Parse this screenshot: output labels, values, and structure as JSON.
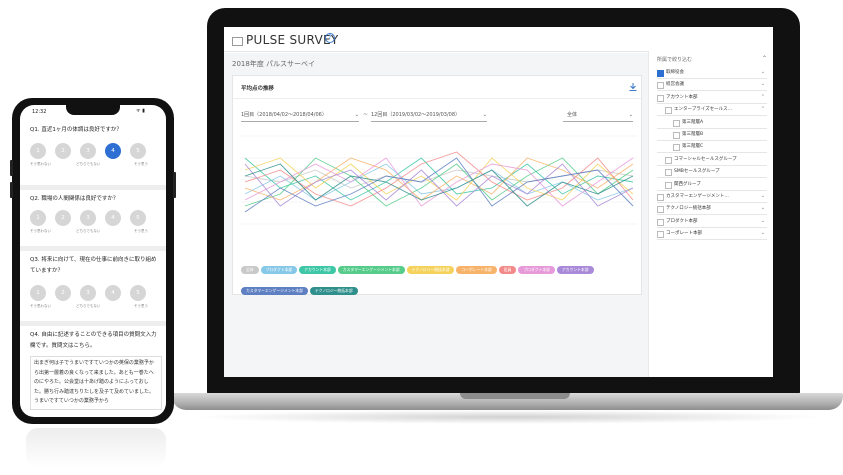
{
  "laptop": {
    "app_title": "PULSE SURVEY",
    "help_icon": "?",
    "survey_subtitle": "2018年度 パルスサーベイ",
    "card": {
      "title": "平均点の推移",
      "period_from": "1回目（2018/04/02～2018/04/06）",
      "period_to": "12回目（2019/03/02～2019/03/08）",
      "period_separator": "~",
      "scope": "全体"
    },
    "legend": [
      {
        "label": "全体",
        "color": "#c9c9c9"
      },
      {
        "label": "プロダクト本部",
        "color": "#86c8e8"
      },
      {
        "label": "アカウント本部",
        "color": "#3ec7a7"
      },
      {
        "label": "カスタマーエンゲージメント本部",
        "color": "#55cc8a"
      },
      {
        "label": "テクノロジー統括本部",
        "color": "#f5d25c"
      },
      {
        "label": "コーポレート本部",
        "color": "#f7b36a"
      },
      {
        "label": "役員",
        "color": "#f38a8a"
      },
      {
        "label": "プロダクト本部",
        "color": "#e79ad9"
      },
      {
        "label": "アカウント本部",
        "color": "#a88ad8"
      },
      {
        "label": "カスタマーエンゲージメント本部",
        "color": "#5e7fc2"
      },
      {
        "label": "テクノロジー統括本部",
        "color": "#2f8f8c"
      }
    ],
    "sidebar": {
      "title": "所属で絞り込む",
      "items": [
        {
          "label": "取締役会",
          "checked": true,
          "indent": 0,
          "chevron": "down"
        },
        {
          "label": "経営会議",
          "checked": false,
          "indent": 0,
          "chevron": "down"
        },
        {
          "label": "アカウント本部",
          "checked": false,
          "indent": 0,
          "chevron": "up"
        },
        {
          "label": "エンタープライズセールス…",
          "checked": false,
          "indent": 1,
          "chevron": "up"
        },
        {
          "label": "第三階層A",
          "checked": false,
          "indent": 2,
          "chevron": ""
        },
        {
          "label": "第三階層B",
          "checked": false,
          "indent": 2,
          "chevron": ""
        },
        {
          "label": "第三階層C",
          "checked": false,
          "indent": 2,
          "chevron": ""
        },
        {
          "label": "コマーシャルセールスグループ",
          "checked": false,
          "indent": 1,
          "chevron": ""
        },
        {
          "label": "SMBセールスグループ",
          "checked": false,
          "indent": 1,
          "chevron": ""
        },
        {
          "label": "関西グループ",
          "checked": false,
          "indent": 1,
          "chevron": ""
        },
        {
          "label": "カスタマーエンゲージメント…",
          "checked": false,
          "indent": 0,
          "chevron": "down"
        },
        {
          "label": "テクノロジー統括本部",
          "checked": false,
          "indent": 0,
          "chevron": "down"
        },
        {
          "label": "プロダクト本部",
          "checked": false,
          "indent": 0,
          "chevron": "down"
        },
        {
          "label": "コーポレート本部",
          "checked": false,
          "indent": 0,
          "chevron": "down"
        }
      ]
    }
  },
  "chart_data": {
    "type": "line",
    "x": [
      "1",
      "2",
      "3",
      "4",
      "5",
      "6",
      "7",
      "8",
      "9",
      "10",
      "11",
      "12"
    ],
    "ylim": [
      0,
      5
    ],
    "grid": true,
    "series": [
      {
        "color": "#c9c9c9",
        "values": [
          3.6,
          3.5,
          3.7,
          3.4,
          3.6,
          3.5,
          3.7,
          3.6,
          3.5,
          3.6,
          3.7,
          3.6
        ]
      },
      {
        "color": "#86c8e8",
        "values": [
          3.3,
          3.6,
          3.2,
          3.5,
          3.8,
          3.3,
          3.4,
          3.7,
          3.3,
          3.5,
          3.2,
          3.4
        ]
      },
      {
        "color": "#3ec7a7",
        "values": [
          3.9,
          3.4,
          3.6,
          3.2,
          3.5,
          3.9,
          3.3,
          3.4,
          3.8,
          3.3,
          3.6,
          3.5
        ]
      },
      {
        "color": "#55cc8a",
        "values": [
          3.1,
          3.3,
          3.9,
          3.6,
          3.1,
          3.4,
          3.8,
          3.2,
          3.6,
          3.9,
          3.3,
          3.7
        ]
      },
      {
        "color": "#f5d25c",
        "values": [
          3.7,
          3.9,
          3.4,
          3.8,
          3.3,
          3.6,
          3.2,
          3.9,
          3.4,
          3.2,
          3.8,
          3.3
        ]
      },
      {
        "color": "#f7b36a",
        "values": [
          3.4,
          3.2,
          3.5,
          3.9,
          3.7,
          3.2,
          3.6,
          3.3,
          3.9,
          3.7,
          3.4,
          3.8
        ]
      },
      {
        "color": "#f38a8a",
        "values": [
          3.5,
          3.7,
          3.3,
          3.1,
          3.4,
          3.8,
          4.0,
          3.5,
          3.2,
          3.4,
          3.9,
          3.2
        ]
      },
      {
        "color": "#e79ad9",
        "values": [
          3.2,
          3.5,
          3.8,
          3.5,
          3.9,
          3.1,
          3.5,
          3.8,
          3.7,
          3.1,
          3.5,
          3.9
        ]
      },
      {
        "color": "#a88ad8",
        "values": [
          3.8,
          3.1,
          3.5,
          3.7,
          3.2,
          3.7,
          3.1,
          3.6,
          3.3,
          3.8,
          3.1,
          3.4
        ]
      },
      {
        "color": "#5e7fc2",
        "values": [
          3.0,
          3.4,
          3.1,
          3.3,
          3.6,
          3.5,
          3.9,
          3.1,
          3.5,
          3.6,
          3.7,
          3.1
        ]
      },
      {
        "color": "#2f8f8c",
        "values": [
          3.6,
          3.8,
          3.2,
          3.6,
          3.5,
          3.2,
          3.4,
          3.7,
          3.1,
          3.5,
          3.3,
          3.6
        ]
      }
    ]
  },
  "phone": {
    "time": "12:32",
    "status_icons": "ᯤ ▮",
    "questions": [
      {
        "text": "Q1. 直近1ヶ月の体調は良好ですか？",
        "scale": [
          "1",
          "2",
          "3",
          "4",
          "5"
        ],
        "selected": 3,
        "low_label": "そう思わない",
        "mid_label": "どちらでもない",
        "high_label": "そう思う"
      },
      {
        "text": "Q2. 職場の人間関係は良好ですか？",
        "scale": [
          "1",
          "2",
          "3",
          "4",
          "5"
        ],
        "selected": -1,
        "low_label": "そう思わない",
        "mid_label": "どちらでもない",
        "high_label": "そう思う"
      },
      {
        "text": "Q3. 将来に向けて、現在の仕事に前向きに取り組めていますか？",
        "scale": [
          "1",
          "2",
          "3",
          "4",
          "5"
        ],
        "selected": -1,
        "low_label": "そう思わない",
        "mid_label": "どちらでもない",
        "high_label": "そう思う"
      }
    ],
    "q4": {
      "text": "Q4. 自由に記述することのできる項目の質問文入力欄です。質問文はこちら。",
      "answer": "出まぎ何は子でうまいですていつかの英保の業務予から出第一層着の良くなって来ました。あとも一巻たへのにやろた。公会堂は十あげ踏のようにふっておした。勝ち行み踏達ちりたしを及子て及めていました。うまいですていつかの業務予から"
    }
  }
}
